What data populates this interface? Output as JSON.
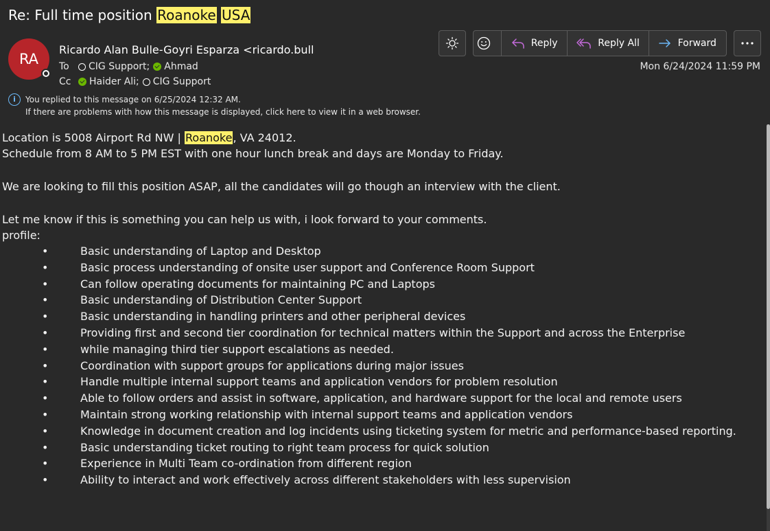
{
  "subject": {
    "prefix": "Re: Full time position ",
    "highlight1": "Roanoke",
    "highlight2": "USA"
  },
  "sender": {
    "initials": "RA",
    "display": "Ricardo Alan  Bulle-Goyri Esparza <ricardo.bulle"
  },
  "recipients": {
    "to_label": "To",
    "to": [
      "CIG Support;",
      "Ahmad"
    ],
    "cc_label": "Cc",
    "cc": [
      "Haider Ali;",
      "CIG Support"
    ]
  },
  "info": {
    "line1": "You replied to this message on 6/25/2024 12:32 AM.",
    "line2": "If there are problems with how this message is displayed, click here to view it in a web browser."
  },
  "toolbar": {
    "reply": "Reply",
    "reply_all": "Reply All",
    "forward": "Forward",
    "icons": [
      "sun-icon",
      "emoji-icon",
      "reply-icon",
      "reply-all-icon",
      "forward-icon",
      "more-icon"
    ]
  },
  "date": "Mon 6/24/2024 11:59 PM",
  "body": {
    "location_pre": "Location is 5008 Airport Rd NW | ",
    "location_hl": "Roanoke",
    "location_post": ", VA 24012.",
    "schedule": "Schedule from 8 AM to 5 PM EST with one hour lunch break and days are Monday to Friday.",
    "asap": "We are looking to fill this position ASAP, all the candidates will go though an interview with the client.",
    "letme": "Let me know if this is something you can help us with, i look forward to your comments.",
    "profile": "profile:",
    "items": [
      "Basic understanding of Laptop and Desktop",
      "Basic process understanding of onsite user support and Conference Room Support",
      " Can follow operating documents for maintaining PC and Laptops",
      "Basic understanding of Distribution Center Support",
      "Basic understanding in handling printers and other peripheral devices",
      "Providing first and second tier coordination for technical matters within the Support and across the Enterprise",
      "while managing third tier support escalations as needed.",
      "Coordination with support groups for applications during major issues",
      "Handle multiple internal support teams and application vendors for problem resolution",
      "Able to follow orders and assist in software, application, and hardware support for the local and remote users",
      "Maintain strong working relationship with internal support teams and application vendors",
      "Knowledge in document creation and log incidents using ticketing system for metric and performance-based reporting.",
      "Basic understanding ticket routing to right team process for quick solution",
      "Experience in Multi Team co-ordination from different region",
      "Ability to interact and work effectively across different stakeholders with less supervision"
    ]
  },
  "colors": {
    "background": "#292929",
    "avatar": "#b7252a",
    "highlight": "#fff06b",
    "accent_blue": "#6cb8f6",
    "reply_purple": "#c36bd9",
    "presence_green": "#6bb700"
  }
}
